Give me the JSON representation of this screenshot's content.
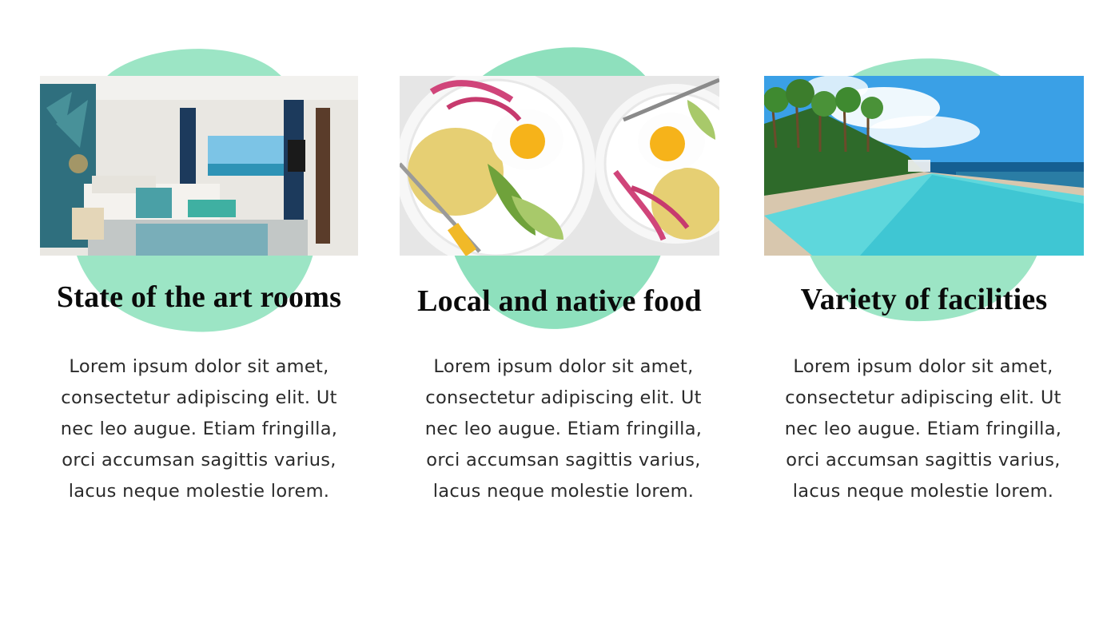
{
  "theme": {
    "accent": "#9ce5c5",
    "accent_dark": "#8ee0bd",
    "text": "#0a0a0a",
    "body_text": "#2b2b2b"
  },
  "features": [
    {
      "title": "State of the art rooms",
      "body": "Lorem ipsum dolor sit amet, consectetur adipiscing elit. Ut nec leo augue. Etiam fringilla, orci accumsan sagittis varius, lacus neque molestie lorem.",
      "image": "hotel-bedroom-photo"
    },
    {
      "title": "Local and native food",
      "body": "Lorem ipsum dolor sit amet, consectetur adipiscing elit. Ut nec leo augue. Etiam fringilla, orci accumsan sagittis varius, lacus neque molestie lorem.",
      "image": "breakfast-plates-photo"
    },
    {
      "title": "Variety of  facilities",
      "body": "Lorem ipsum dolor sit amet, consectetur adipiscing elit. Ut nec leo augue. Etiam fringilla, orci accumsan sagittis varius, lacus neque molestie lorem.",
      "image": "infinity-pool-photo"
    }
  ]
}
